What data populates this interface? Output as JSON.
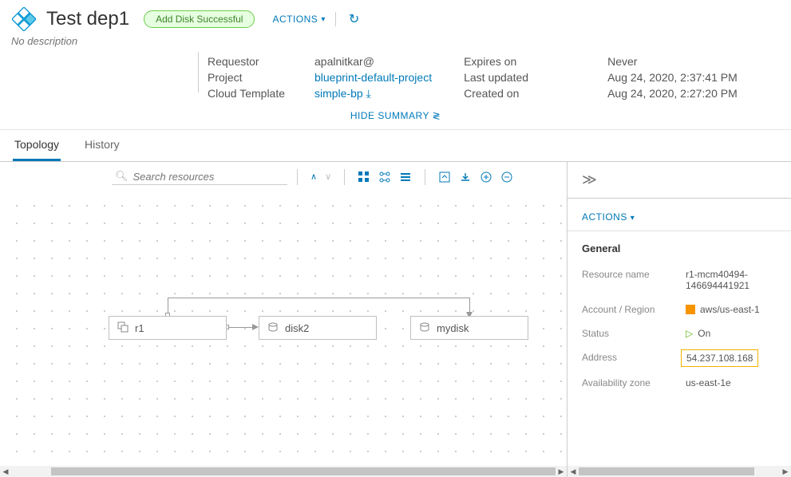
{
  "header": {
    "title": "Test dep1",
    "badge": "Add Disk Successful",
    "actions_label": "ACTIONS"
  },
  "subtitle": "No description",
  "summary": {
    "requestor_label": "Requestor",
    "requestor": "apalnitkar@",
    "project_label": "Project",
    "project": "blueprint-default-project",
    "template_label": "Cloud Template",
    "template": "simple-bp",
    "expires_label": "Expires on",
    "expires": "Never",
    "updated_label": "Last updated",
    "updated": "Aug 24, 2020, 2:37:41 PM",
    "created_label": "Created on",
    "created": "Aug 24, 2020, 2:27:20 PM",
    "hide_label": "HIDE SUMMARY"
  },
  "tabs": {
    "topology": "Topology",
    "history": "History"
  },
  "toolbar": {
    "search_placeholder": "Search resources"
  },
  "nodes": {
    "r1": "r1",
    "disk2": "disk2",
    "mydisk": "mydisk"
  },
  "side": {
    "actions_label": "ACTIONS",
    "section_title": "General",
    "resource_name_label": "Resource name",
    "resource_name": "r1-mcm40494-146694441921",
    "account_label": "Account / Region",
    "account": "aws/us-east-1",
    "status_label": "Status",
    "status": "On",
    "address_label": "Address",
    "address": "54.237.108.168",
    "az_label": "Availability zone",
    "az": "us-east-1e"
  }
}
